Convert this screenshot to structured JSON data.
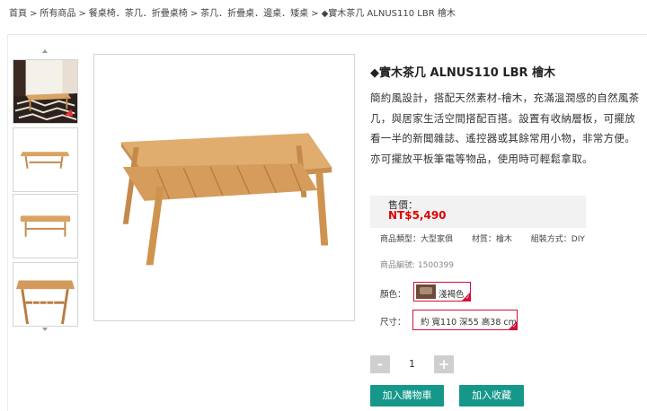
{
  "breadcrumb": {
    "items": [
      "首頁",
      "所有商品",
      "餐桌椅．茶几．折疊桌椅",
      "茶几．折疊桌．邊桌．矮桌",
      "◆實木茶几 ALNUS110 LBR 檜木"
    ],
    "separator": ">"
  },
  "gallery": {
    "thumbnails": [
      "living-room-scene",
      "table-front-view",
      "table-top-view",
      "table-side-view"
    ]
  },
  "product": {
    "title": "◆實木茶几 ALNUS110 LBR 檜木",
    "description": "簡約風設計，搭配天然素材-檜木，充滿溫潤感的自然風茶几，與居家生活空間搭配百搭。設置有收納層板，可擺放看一半的新聞雜誌、遙控器或其餘常用小物，非常方便。亦可擺放平板筆電等物品，使用時可輕鬆拿取。",
    "price_label": "售價：",
    "price": "NT$5,490",
    "specs": {
      "type": "商品類型：大型家俱",
      "material": "材質：檜木",
      "assembly": "組裝方式：DIY"
    },
    "code": "商品編號: 1500399"
  },
  "options": {
    "color_label": "顏色：",
    "color_value": "淺褐色",
    "size_label": "尺寸：",
    "size_value": "約 寬110 深55 高38 cm"
  },
  "quantity": {
    "minus": "-",
    "value": "1",
    "plus": "+"
  },
  "actions": {
    "add_to_cart": "加入購物車",
    "add_to_favorites": "加入收藏"
  },
  "colors": {
    "price_red": "#e10000",
    "button_teal": "#15988a",
    "chip_border": "#d0103a",
    "wood": "#d9a363"
  }
}
